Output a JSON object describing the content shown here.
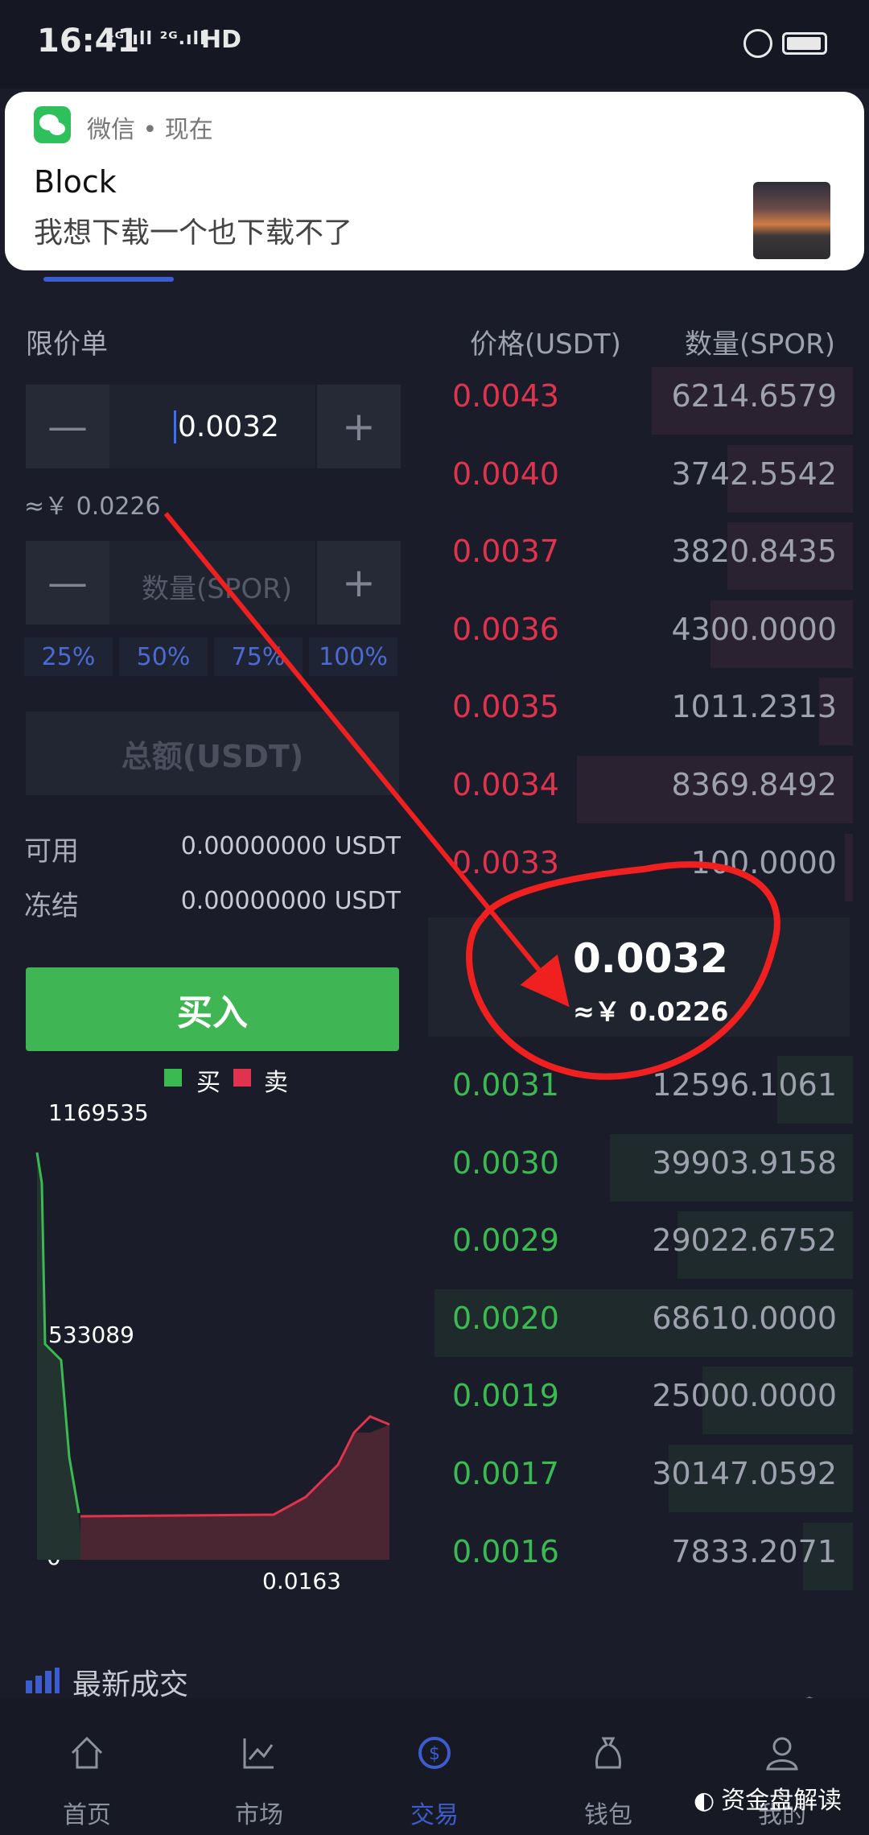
{
  "status_bar": {
    "time": "16:41",
    "network": "⁴ᴳ.ıll ²ᴳ.ıll",
    "hd": "HD"
  },
  "notification": {
    "app": "微信 • 现在",
    "title": "Block",
    "body": "我想下载一个也下载不了"
  },
  "order_form": {
    "type_label": "限价单",
    "price_value": "0.0032",
    "price_cny": "≈￥ 0.0226",
    "qty_placeholder": "数量(SPOR)",
    "percentages": [
      "25%",
      "50%",
      "75%",
      "100%"
    ],
    "total_placeholder": "总额(USDT)",
    "available_label": "可用",
    "available_value": "0.00000000 USDT",
    "frozen_label": "冻结",
    "frozen_value": "0.00000000 USDT",
    "buy_button": "买入"
  },
  "order_book": {
    "price_header": "价格(USDT)",
    "qty_header": "数量(SPOR)",
    "asks": [
      {
        "price": "0.0043",
        "qty": "6214.6579",
        "depth": 0.48
      },
      {
        "price": "0.0040",
        "qty": "3742.5542",
        "depth": 0.3
      },
      {
        "price": "0.0037",
        "qty": "3820.8435",
        "depth": 0.3
      },
      {
        "price": "0.0036",
        "qty": "4300.0000",
        "depth": 0.34
      },
      {
        "price": "0.0035",
        "qty": "1011.2313",
        "depth": 0.08
      },
      {
        "price": "0.0034",
        "qty": "8369.8492",
        "depth": 0.66
      },
      {
        "price": "0.0033",
        "qty": "100.0000",
        "depth": 0.02
      }
    ],
    "last_price": "0.0032",
    "last_price_cny": "≈￥ 0.0226",
    "bids": [
      {
        "price": "0.0031",
        "qty": "12596.1061",
        "depth": 0.18
      },
      {
        "price": "0.0030",
        "qty": "39903.9158",
        "depth": 0.58
      },
      {
        "price": "0.0029",
        "qty": "29022.6752",
        "depth": 0.42
      },
      {
        "price": "0.0020",
        "qty": "68610.0000",
        "depth": 1.0
      },
      {
        "price": "0.0019",
        "qty": "25000.0000",
        "depth": 0.36
      },
      {
        "price": "0.0017",
        "qty": "30147.0592",
        "depth": 0.44
      },
      {
        "price": "0.0016",
        "qty": "7833.2071",
        "depth": 0.12
      }
    ]
  },
  "depth_chart": {
    "legend_buy": "买",
    "legend_sell": "卖",
    "y_top": "1169535",
    "y_mid": "533089",
    "y_zero": "0",
    "x_label": "0.0163",
    "colors": {
      "buy": "#3cba52",
      "sell": "#e0334e"
    }
  },
  "latest_trades_label": "最新成交",
  "bottom_nav": [
    {
      "label": "首页",
      "icon": "home-icon"
    },
    {
      "label": "市场",
      "icon": "chart-icon"
    },
    {
      "label": "交易",
      "icon": "trade-icon"
    },
    {
      "label": "钱包",
      "icon": "wallet-icon"
    },
    {
      "label": "我的",
      "icon": "profile-icon"
    }
  ],
  "watermark": "资金盘解读"
}
